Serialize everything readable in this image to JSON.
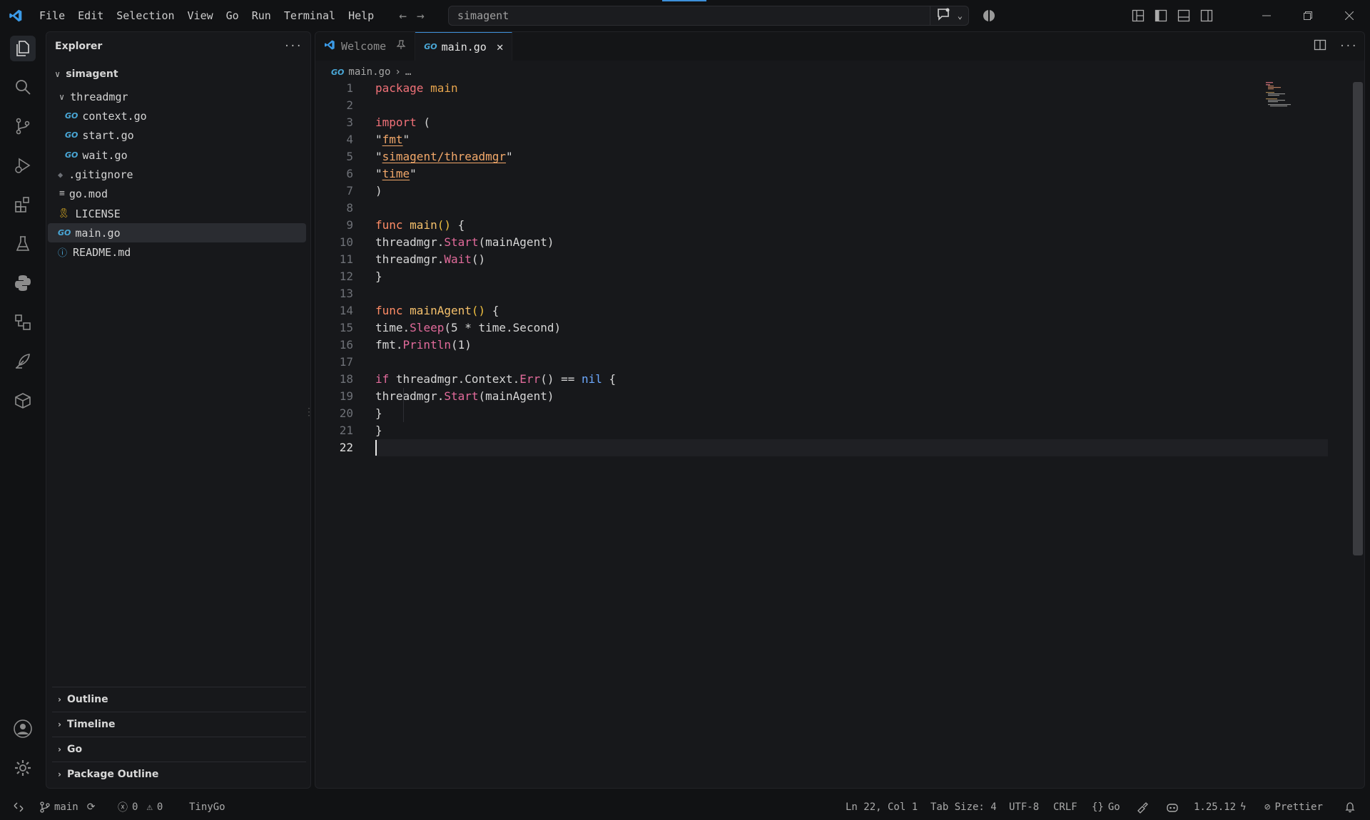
{
  "titlebar": {
    "menus": [
      "File",
      "Edit",
      "Selection",
      "View",
      "Go",
      "Run",
      "Terminal",
      "Help"
    ],
    "search_text": "simagent"
  },
  "explorer": {
    "title": "Explorer",
    "root": "simagent",
    "folder": "threadmgr",
    "folder_files": [
      "context.go",
      "start.go",
      "wait.go"
    ],
    "files": [
      ".gitignore",
      "go.mod",
      "LICENSE",
      "main.go",
      "README.md"
    ],
    "sections": [
      "Outline",
      "Timeline",
      "Go",
      "Package Outline"
    ]
  },
  "tabs": [
    {
      "label": "Welcome"
    },
    {
      "label": "main.go"
    }
  ],
  "breadcrumb": {
    "file": "main.go",
    "rest": "…"
  },
  "code_lines": [
    "package main",
    "",
    "import (",
    "    \"fmt\"",
    "    \"simagent/threadmgr\"",
    "    \"time\"",
    ")",
    "",
    "func main() {",
    "    threadmgr.Start(mainAgent)",
    "    threadmgr.Wait()",
    "}",
    "",
    "func mainAgent() {",
    "    time.Sleep(5 * time.Second)",
    "    fmt.Println(1)",
    "",
    "    if threadmgr.Context.Err() == nil {",
    "        threadmgr.Start(mainAgent)",
    "    }",
    "}",
    ""
  ],
  "line_numbers": [
    "1",
    "2",
    "3",
    "4",
    "5",
    "6",
    "7",
    "8",
    "9",
    "10",
    "11",
    "12",
    "13",
    "14",
    "15",
    "16",
    "17",
    "18",
    "19",
    "20",
    "21",
    "22"
  ],
  "statusbar": {
    "branch": "main",
    "errors": "0",
    "warnings": "0",
    "tinygo": "TinyGo",
    "position": "Ln 22, Col 1",
    "tab_size": "Tab Size: 4",
    "encoding": "UTF-8",
    "eol": "CRLF",
    "language": "Go",
    "go_version": "1.25.12",
    "prettier": "Prettier"
  },
  "colors": {
    "accent": "#3d8fd9",
    "background": "#17181b"
  }
}
